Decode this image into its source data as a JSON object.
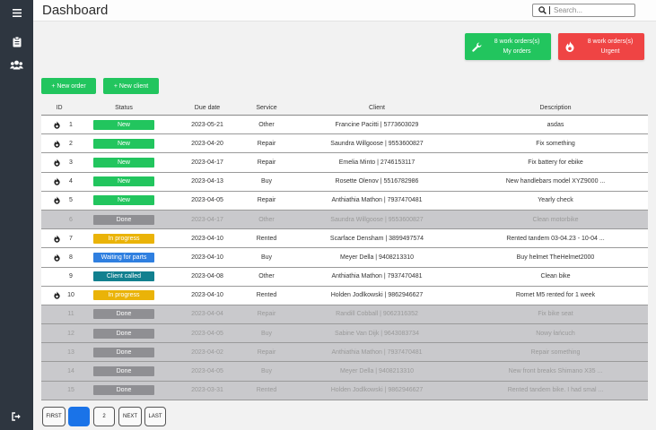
{
  "header": {
    "title": "Dashboard"
  },
  "search": {
    "placeholder": "Search..."
  },
  "cards": {
    "my_orders": {
      "line1": "8 work orders(s)",
      "line2": "My orders"
    },
    "urgent": {
      "line1": "8 work orders(s)",
      "line2": "Urgent"
    }
  },
  "actions": {
    "new_order": "+ New order",
    "new_client": "+ New client"
  },
  "table": {
    "headers": {
      "id": "ID",
      "status": "Status",
      "due": "Due date",
      "service": "Service",
      "client": "Client",
      "description": "Description"
    },
    "rows": [
      {
        "urgent": true,
        "id": "1",
        "status": "New",
        "status_kind": "new",
        "due": "2023-05-21",
        "service": "Other",
        "client": "Francine Pacitti | 5773603029",
        "description": "asdas"
      },
      {
        "urgent": true,
        "id": "2",
        "status": "New",
        "status_kind": "new",
        "due": "2023-04-20",
        "service": "Repair",
        "client": "Saundra Willgoose | 9553600827",
        "description": "Fix something"
      },
      {
        "urgent": true,
        "id": "3",
        "status": "New",
        "status_kind": "new",
        "due": "2023-04-17",
        "service": "Repair",
        "client": "Emelia Minto | 2746153117",
        "description": "Fix battery for ebike"
      },
      {
        "urgent": true,
        "id": "4",
        "status": "New",
        "status_kind": "new",
        "due": "2023-04-13",
        "service": "Buy",
        "client": "Rosette Olenov | 5516782986",
        "description": "New handlebars model XYZ9000 ..."
      },
      {
        "urgent": true,
        "id": "5",
        "status": "New",
        "status_kind": "new",
        "due": "2023-04-05",
        "service": "Repair",
        "client": "Anthiathia Mathon | 7937470481",
        "description": "Yearly check"
      },
      {
        "urgent": false,
        "id": "6",
        "status": "Done",
        "status_kind": "done",
        "due": "2023-04-17",
        "service": "Other",
        "client": "Saundra Willgoose | 9553600827",
        "description": "Clean motorbike"
      },
      {
        "urgent": true,
        "id": "7",
        "status": "In progress",
        "status_kind": "progress",
        "due": "2023-04-10",
        "service": "Rented",
        "client": "Scarface Densham | 3899497574",
        "description": "Rented tandem 03-04.23 - 10-04 ..."
      },
      {
        "urgent": true,
        "id": "8",
        "status": "Waiting for parts",
        "status_kind": "waiting",
        "due": "2023-04-10",
        "service": "Buy",
        "client": "Meyer Della | 9408213310",
        "description": "Buy helmet TheHelmet2000"
      },
      {
        "urgent": false,
        "id": "9",
        "status": "Client called",
        "status_kind": "called",
        "due": "2023-04-08",
        "service": "Other",
        "client": "Anthiathia Mathon | 7937470481",
        "description": "Clean bike"
      },
      {
        "urgent": true,
        "id": "10",
        "status": "In progress",
        "status_kind": "progress",
        "due": "2023-04-10",
        "service": "Rented",
        "client": "Holden Jodlkowski | 9862946627",
        "description": "Romet M5 rented for 1 week"
      },
      {
        "urgent": false,
        "id": "11",
        "status": "Done",
        "status_kind": "done",
        "due": "2023-04-04",
        "service": "Repair",
        "client": "Randill Cobball | 9062316352",
        "description": "Fix bike seat"
      },
      {
        "urgent": false,
        "id": "12",
        "status": "Done",
        "status_kind": "done",
        "due": "2023-04-05",
        "service": "Buy",
        "client": "Sabine Van Dijk | 9643083734",
        "description": "Nowy łańcuch"
      },
      {
        "urgent": false,
        "id": "13",
        "status": "Done",
        "status_kind": "done",
        "due": "2023-04-02",
        "service": "Repair",
        "client": "Anthiathia Mathon | 7937470481",
        "description": "Repair something"
      },
      {
        "urgent": false,
        "id": "14",
        "status": "Done",
        "status_kind": "done",
        "due": "2023-04-05",
        "service": "Buy",
        "client": "Meyer Della | 9408213310",
        "description": "New front breaks Shimano X35 ..."
      },
      {
        "urgent": false,
        "id": "15",
        "status": "Done",
        "status_kind": "done",
        "due": "2023-03-31",
        "service": "Rented",
        "client": "Holden Jodlkowski | 9862946627",
        "description": "Rented tandem bike. I had smal ..."
      }
    ]
  },
  "pagination": {
    "first": "FIRST",
    "pages": [
      "1",
      "2"
    ],
    "current": "1",
    "next": "NEXT",
    "last": "LAST"
  },
  "colors": {
    "sidebar": "#2e3640",
    "green": "#22c55e",
    "red": "#ef4444",
    "yellow": "#eab308",
    "blue": "#2f7fe0",
    "teal": "#12808f",
    "done_row": "#c9c9cc"
  },
  "icons": {
    "menu": "hamburger-icon",
    "orders": "clipboard-icon",
    "clients": "users-icon",
    "logout": "logout-icon",
    "search": "search-icon",
    "wrench": "wrench-icon",
    "urgent": "flame-icon"
  }
}
